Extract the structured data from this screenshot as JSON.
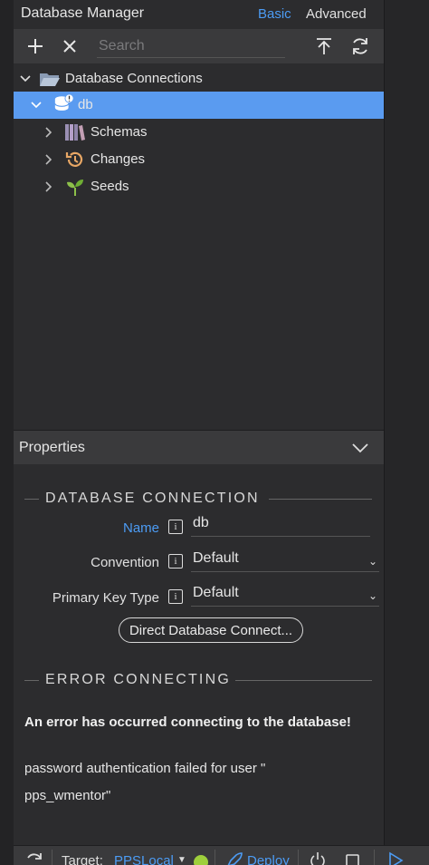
{
  "header": {
    "title": "Database Manager",
    "mode_basic": "Basic",
    "mode_advanced": "Advanced"
  },
  "toolbar": {
    "search_placeholder": "Search"
  },
  "tree": {
    "root_label": "Database Connections",
    "db_label": "db",
    "children": [
      "Schemas",
      "Changes",
      "Seeds"
    ]
  },
  "properties": {
    "header_label": "Properties",
    "section_db": "DATABASE CONNECTION",
    "name_label": "Name",
    "name_value": "db",
    "convention_label": "Convention",
    "convention_value": "Default",
    "pk_label": "Primary Key Type",
    "pk_value": "Default",
    "direct_button": "Direct Database Connect...",
    "section_error": "ERROR CONNECTING",
    "error_title": "An error has occurred connecting to the database!",
    "error_message": "password authentication failed for user \" pps_wmentor\""
  },
  "statusbar": {
    "target_label": "Target:",
    "target_value": "PPSLocal",
    "deploy_label": "Deploy"
  },
  "colors": {
    "accent": "#4c9cf5",
    "selection": "#5a9bf0",
    "panel": "#2c2c2e"
  }
}
